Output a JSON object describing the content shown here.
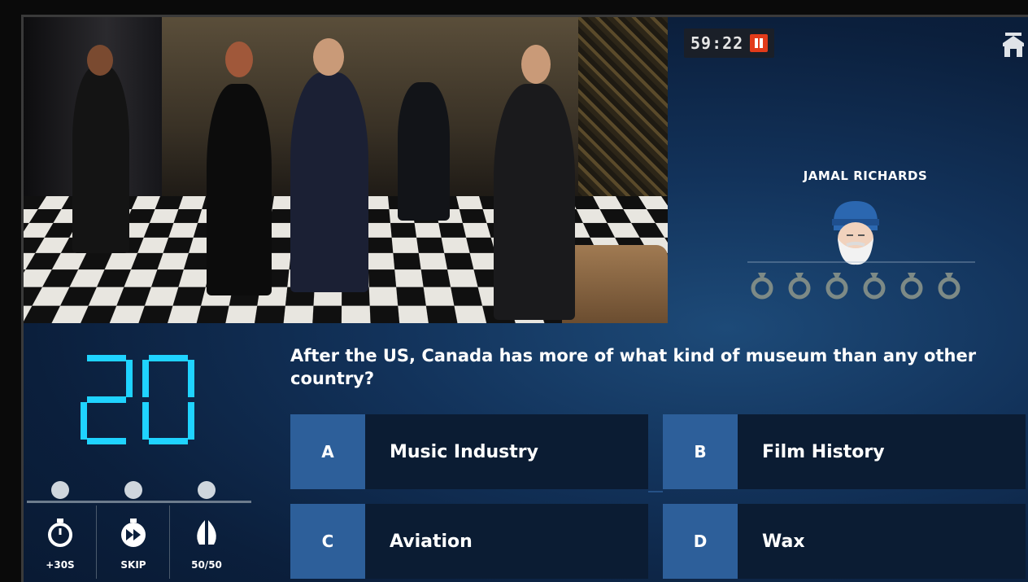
{
  "hud": {
    "game_clock": "59:22",
    "pause_icon": "pause-icon",
    "home_icon": "home-icon"
  },
  "player": {
    "name": "JAMAL RICHARDS",
    "avatar_icon": "bearded-man-avatar-icon",
    "lives_total": 6,
    "life_icon": "ring-icon"
  },
  "countdown": {
    "value": "20",
    "color": "#1fd3ff"
  },
  "lifelines": [
    {
      "label": "+30S",
      "icon": "stopwatch-icon"
    },
    {
      "label": "SKIP",
      "icon": "fast-forward-icon"
    },
    {
      "label": "50/50",
      "icon": "split-halves-icon"
    }
  ],
  "question": {
    "text": "After the US, Canada has more of what kind of museum than any other country?"
  },
  "answers": [
    {
      "letter": "A",
      "text": "Music Industry"
    },
    {
      "letter": "B",
      "text": "Film History"
    },
    {
      "letter": "C",
      "text": "Aviation"
    },
    {
      "letter": "D",
      "text": "Wax"
    }
  ],
  "colors": {
    "letter_box": "#2d5f9a",
    "answer_box": "#0b1c33",
    "pause_button": "#e23b1a"
  }
}
